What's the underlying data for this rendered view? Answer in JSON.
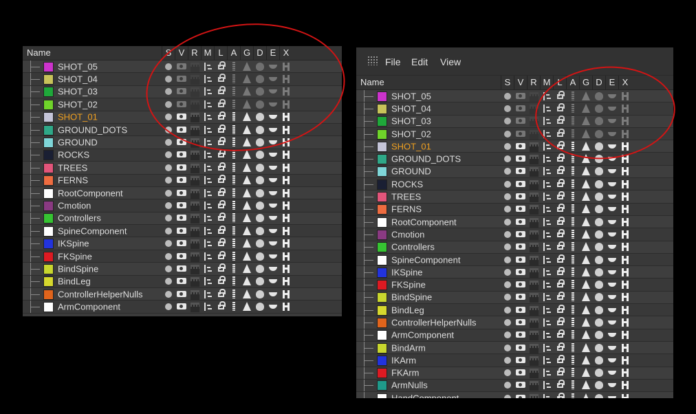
{
  "columns": [
    "S",
    "V",
    "R",
    "M",
    "L",
    "A",
    "G",
    "D",
    "E",
    "X"
  ],
  "name_header": "Name",
  "menu": [
    "File",
    "Edit",
    "View"
  ],
  "icons": {
    "S": "solo-dot-icon",
    "V": "visibility-eye-icon",
    "R": "render-clapper-icon",
    "M": "manipulate-icon",
    "L": "lock-icon",
    "A": "animation-icon",
    "G": "generator-icon",
    "D": "deformer-icon",
    "E": "expression-icon",
    "X": "xref-icon"
  },
  "left_layers": [
    {
      "name": "SHOT_05",
      "color": "#cc33cc",
      "dim": true
    },
    {
      "name": "SHOT_04",
      "color": "#c8c35a",
      "dim": true
    },
    {
      "name": "SHOT_03",
      "color": "#1fa83a",
      "dim": true
    },
    {
      "name": "SHOT_02",
      "color": "#6fd42a",
      "dim": true
    },
    {
      "name": "SHOT_01",
      "color": "#c4c4d8",
      "dim": false,
      "active": true
    },
    {
      "name": "GROUND_DOTS",
      "color": "#2fa888",
      "dim": false
    },
    {
      "name": "GROUND",
      "color": "#7fd6d8",
      "dim": false
    },
    {
      "name": "ROCKS",
      "color": "#1a1f33",
      "dim": false
    },
    {
      "name": "TREES",
      "color": "#e2557a",
      "dim": false
    },
    {
      "name": "FERNS",
      "color": "#ee6c40",
      "dim": false
    },
    {
      "name": "RootComponent",
      "color": "#ffffff",
      "dim": false
    },
    {
      "name": "Cmotion",
      "color": "#8a3a82",
      "dim": false
    },
    {
      "name": "Controllers",
      "color": "#36c432",
      "dim": false
    },
    {
      "name": "SpineComponent",
      "color": "#ffffff",
      "dim": false
    },
    {
      "name": "IKSpine",
      "color": "#2233dd",
      "dim": false
    },
    {
      "name": "FKSpine",
      "color": "#dd1a22",
      "dim": false
    },
    {
      "name": "BindSpine",
      "color": "#c8d62e",
      "dim": false
    },
    {
      "name": "BindLeg",
      "color": "#d6d82e",
      "dim": false
    },
    {
      "name": "ControllerHelperNulls",
      "color": "#e0641c",
      "dim": false
    },
    {
      "name": "ArmComponent",
      "color": "#ffffff",
      "dim": false
    }
  ],
  "right_layers": [
    {
      "name": "SHOT_05",
      "color": "#cc33cc",
      "dim": true
    },
    {
      "name": "SHOT_04",
      "color": "#c8c35a",
      "dim": true
    },
    {
      "name": "SHOT_03",
      "color": "#1fa83a",
      "dim": true
    },
    {
      "name": "SHOT_02",
      "color": "#6fd42a",
      "dim": true
    },
    {
      "name": "SHOT_01",
      "color": "#c4c4d8",
      "dim": false,
      "active": true
    },
    {
      "name": "GROUND_DOTS",
      "color": "#2fa888",
      "dim": false
    },
    {
      "name": "GROUND",
      "color": "#7fd6d8",
      "dim": false
    },
    {
      "name": "ROCKS",
      "color": "#1a1f33",
      "dim": false
    },
    {
      "name": "TREES",
      "color": "#e2557a",
      "dim": false
    },
    {
      "name": "FERNS",
      "color": "#ee6c40",
      "dim": false
    },
    {
      "name": "RootComponent",
      "color": "#ffffff",
      "dim": false
    },
    {
      "name": "Cmotion",
      "color": "#8a3a82",
      "dim": false
    },
    {
      "name": "Controllers",
      "color": "#36c432",
      "dim": false
    },
    {
      "name": "SpineComponent",
      "color": "#ffffff",
      "dim": false
    },
    {
      "name": "IKSpine",
      "color": "#2233dd",
      "dim": false
    },
    {
      "name": "FKSpine",
      "color": "#dd1a22",
      "dim": false
    },
    {
      "name": "BindSpine",
      "color": "#c8d62e",
      "dim": false
    },
    {
      "name": "BindLeg",
      "color": "#d6d82e",
      "dim": false
    },
    {
      "name": "ControllerHelperNulls",
      "color": "#e0641c",
      "dim": false
    },
    {
      "name": "ArmComponent",
      "color": "#ffffff",
      "dim": false
    },
    {
      "name": "BindArm",
      "color": "#c8d62e",
      "dim": false
    },
    {
      "name": "IKArm",
      "color": "#2233dd",
      "dim": false
    },
    {
      "name": "FKArm",
      "color": "#dd1a22",
      "dim": false
    },
    {
      "name": "ArmNulls",
      "color": "#1f9a8a",
      "dim": false
    },
    {
      "name": "HandComponent",
      "color": "#ffffff",
      "dim": false
    }
  ],
  "annotation_color": "#d21414",
  "active_label_color": "#f0a020"
}
